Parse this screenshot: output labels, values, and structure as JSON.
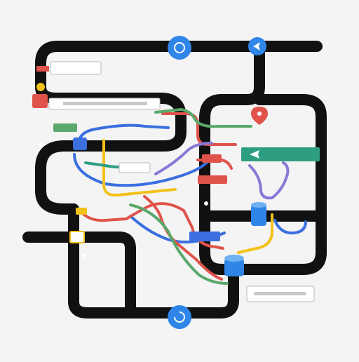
{
  "colors": {
    "background": "#f4f4f4",
    "track": "#111111",
    "blue": "#3b6fe0",
    "red": "#e0534a",
    "green": "#5aa86b",
    "yellow": "#f2c21b",
    "purple": "#8a78d6",
    "teal": "#2e9e82",
    "node_blue": "#2f86e8"
  },
  "icons": {
    "top_node": "circle-icon",
    "top_right_node": "arrow-left-icon",
    "bottom_node": "refresh-icon",
    "right_top_marker": "location-pin-icon",
    "right_green_box": "arrow-right-icon",
    "right_cylinder": "database-icon",
    "bottom_right_cylinder": "database-icon"
  }
}
